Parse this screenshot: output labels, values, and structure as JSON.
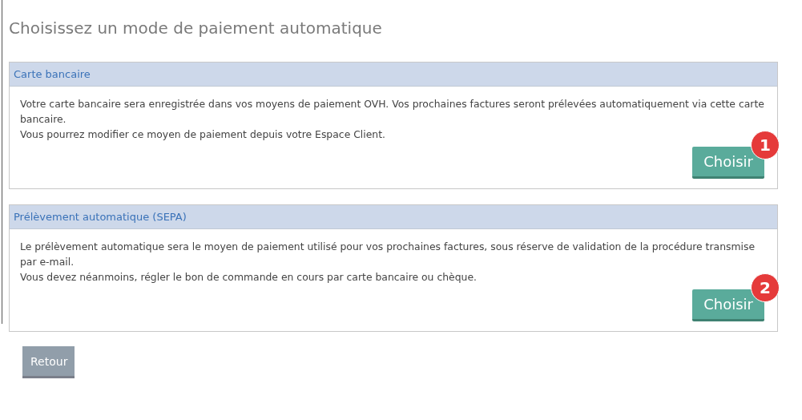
{
  "title": "Choisissez un mode de paiement automatique",
  "panels": [
    {
      "heading": "Carte bancaire",
      "paragraphs": [
        "Votre carte bancaire sera enregistrée dans vos moyens de paiement OVH. Vos prochaines factures seront prélevées automatiquement via cette carte bancaire.",
        "Vous pourrez modifier ce moyen de paiement depuis votre Espace Client."
      ],
      "button": "Choisir",
      "badge": "1"
    },
    {
      "heading": "Prélèvement automatique (SEPA)",
      "paragraphs": [
        "Le prélèvement automatique sera le moyen de paiement utilisé pour vos prochaines factures, sous réserve de validation de la procédure transmise par e-mail.",
        "Vous devez néanmoins, régler le bon de commande en cours par carte bancaire ou chèque."
      ],
      "button": "Choisir",
      "badge": "2"
    }
  ],
  "back_button": "Retour"
}
